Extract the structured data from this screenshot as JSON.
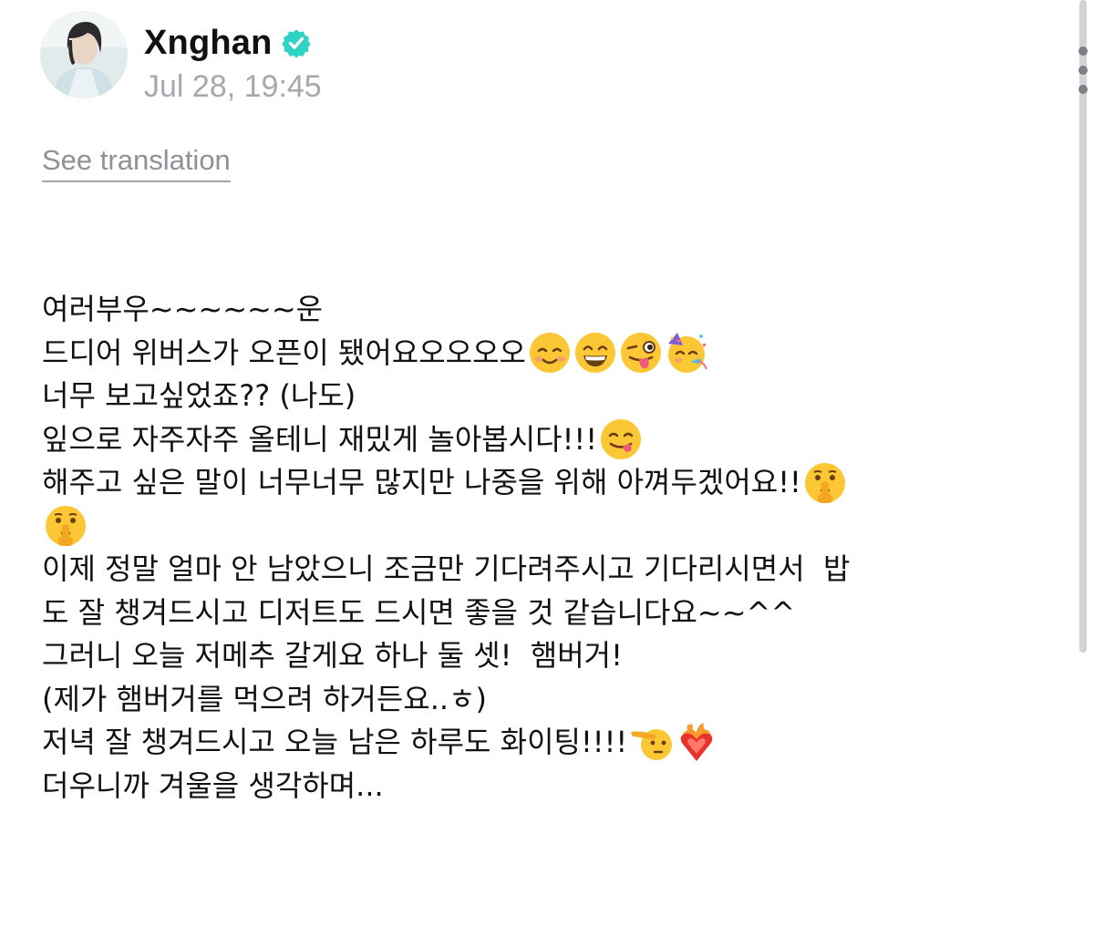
{
  "post": {
    "author": {
      "name": "Xnghan",
      "avatar_icon": "profile-photo",
      "verified_icon": "verified-badge-icon",
      "verified_color": "#2ed3c3"
    },
    "timestamp": "Jul 28, 19:45",
    "more_icon": "vertical-ellipsis-icon",
    "see_translation_label": "See translation",
    "lines": [
      {
        "text": "여러부우~~~~~~운",
        "emojis": []
      },
      {
        "text": "드디어 위버스가 오픈이 됐어요오오오오",
        "emojis": [
          "smiling-face-icon",
          "grinning-face-icon",
          "winking-tongue-face-icon",
          "partying-face-icon"
        ]
      },
      {
        "text": "너무 보고싶었죠?? (나도)",
        "emojis": []
      },
      {
        "text": "잎으로 자주자주 올테니 재밌게 놀아봅시다!!!",
        "emojis": [
          "yummy-face-icon"
        ]
      },
      {
        "text": "해주고 싶은 말이 너무너무 많지만 나중을 위해 아껴두겠어요!!",
        "emojis": [
          "shushing-face-icon"
        ]
      },
      {
        "text": "",
        "emojis": [
          "shushing-face-icon"
        ]
      },
      {
        "text": "이제 정말 얼마 안 남았으니 조금만 기다려주시고 기다리시면서  밥",
        "emojis": []
      },
      {
        "text": "도 잘 챙겨드시고 디저트도 드시면 좋을 것 같습니다요~~^^",
        "emojis": []
      },
      {
        "text": "그러니 오늘 저메추 갈게요 하나 둘 셋!  햄버거!",
        "emojis": []
      },
      {
        "text": "(제가 햄버거를 먹으려 하거든요..ㅎ)",
        "emojis": []
      },
      {
        "text": "저녁 잘 챙겨드시고 오늘 남은 하루도 화이팅!!!!",
        "emojis": [
          "saluting-face-icon",
          "heart-on-fire-icon"
        ]
      },
      {
        "text": "더우니까 겨울을 생각하며...",
        "emojis": []
      }
    ]
  },
  "colors": {
    "text": "#111111",
    "muted": "#a6a8ad",
    "verified": "#2ed3c3"
  }
}
